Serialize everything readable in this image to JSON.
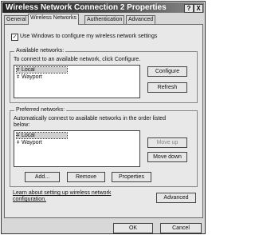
{
  "window": {
    "title": "Wireless Network Connection 2 Properties",
    "help_label": "?",
    "close_label": "X"
  },
  "tabs": [
    {
      "label": "General"
    },
    {
      "label": "Wireless Networks"
    },
    {
      "label": "Authentication"
    },
    {
      "label": "Advanced"
    }
  ],
  "use_windows": {
    "checked": true,
    "check_glyph": "✓",
    "label": "Use Windows to configure my wireless network settings"
  },
  "available": {
    "legend": "Available networks:",
    "instruction": "To connect to an available network, click Configure.",
    "networks": [
      "Local",
      "Wayport"
    ],
    "configure_label": "Configure",
    "refresh_label": "Refresh"
  },
  "preferred": {
    "legend": "Preferred networks:",
    "instruction_line1": "Automatically connect to available networks in the order listed",
    "instruction_line2": "below:",
    "networks": [
      "Local",
      "Wayport"
    ],
    "move_up_label": "Move up",
    "move_down_label": "Move down",
    "add_label": "Add...",
    "remove_label": "Remove",
    "properties_label": "Properties"
  },
  "learn": {
    "line1": "Learn about setting up wireless network",
    "line2": "configuration.",
    "advanced_label": "Advanced"
  },
  "footer": {
    "ok_label": "OK",
    "cancel_label": "Cancel"
  }
}
